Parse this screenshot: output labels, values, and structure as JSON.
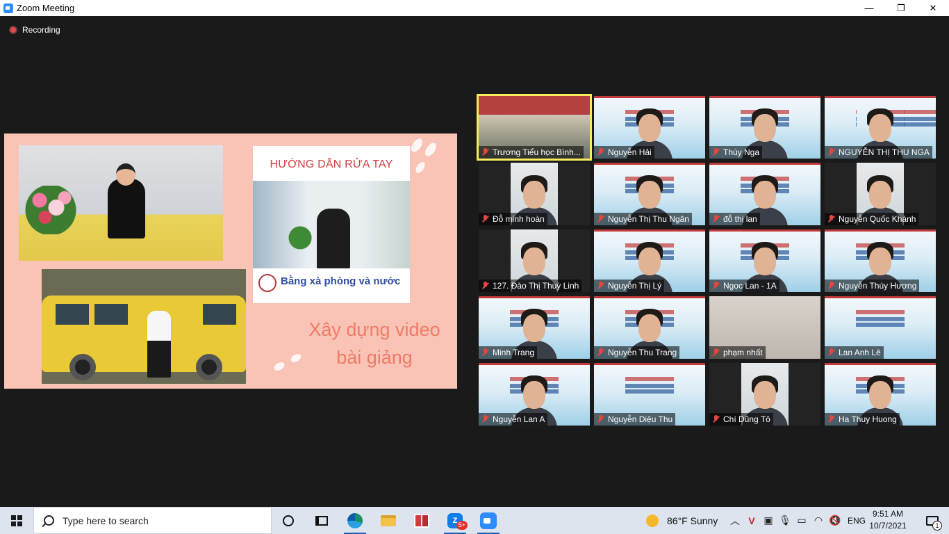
{
  "window": {
    "title": "Zoom Meeting",
    "minimize": "—",
    "restore": "❐",
    "close": "✕"
  },
  "recording": {
    "label": "Recording"
  },
  "slide": {
    "card_title": "HƯỚNG DẪN RỬA TAY",
    "card_subtitle": "Bằng xà phòng và nước",
    "headline_line1": "Xây dựng video",
    "headline_line2": "bài giảng"
  },
  "gallery": [
    {
      "name": "Trương Tiểu học Bình...",
      "muted": true,
      "active": true
    },
    {
      "name": "Nguyễn Hải",
      "muted": true
    },
    {
      "name": "Thúy Nga",
      "muted": true
    },
    {
      "name": "NGUYỄN THỊ THU NGA",
      "muted": true
    },
    {
      "name": "Đỗ minh hoàn",
      "muted": true
    },
    {
      "name": "Nguyễn Thị Thu Ngân",
      "muted": true
    },
    {
      "name": "đỗ thị lan",
      "muted": true
    },
    {
      "name": "Nguyễn Quốc Khánh",
      "muted": true
    },
    {
      "name": "127. Đào Thị Thuỳ Linh",
      "muted": true
    },
    {
      "name": "Nguyễn Thị Lý",
      "muted": true
    },
    {
      "name": "Ngọc Lan - 1A",
      "muted": true
    },
    {
      "name": "Nguyễn Thúy Hương",
      "muted": true
    },
    {
      "name": "Minh Trang",
      "muted": true
    },
    {
      "name": "Nguyễn Thu Trang",
      "muted": true
    },
    {
      "name": "phạm nhất",
      "muted": true
    },
    {
      "name": "Lan Anh Lê",
      "muted": true
    },
    {
      "name": "Nguyễn Lan A",
      "muted": true
    },
    {
      "name": "Nguyễn Diệu Thu",
      "muted": true
    },
    {
      "name": "Chí Dũng Tô",
      "muted": true
    },
    {
      "name": "Ha Thuy Huong",
      "muted": true
    }
  ],
  "taskbar": {
    "search_placeholder": "Type here to search",
    "zalo_label": "Z",
    "zalo_badge": "5+",
    "weather": "86°F  Sunny",
    "language": "ENG",
    "time": "9:51 AM",
    "date": "10/7/2021",
    "notifications": "1"
  },
  "tray_icons": [
    "chevron-up-icon",
    "antivirus-icon",
    "meet-now-icon",
    "microphone-icon",
    "battery-icon",
    "wifi-icon",
    "volume-muted-icon"
  ]
}
